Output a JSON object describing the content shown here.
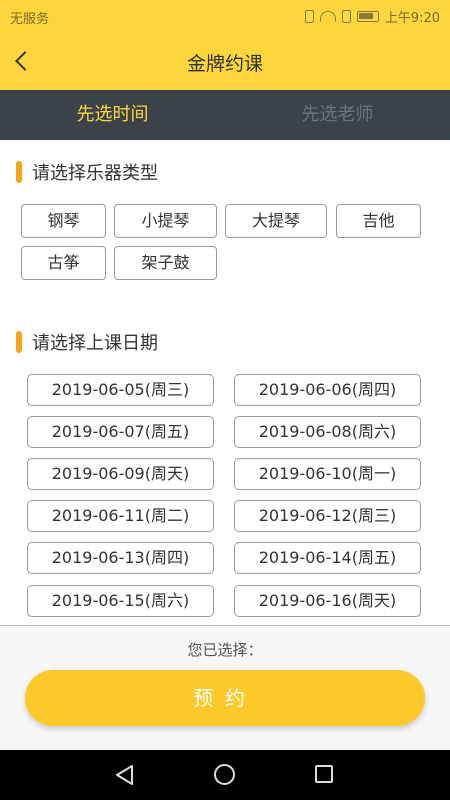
{
  "status_bar": {
    "carrier": "无服务",
    "time": "上午9:20"
  },
  "header": {
    "title": "金牌约课"
  },
  "tabs": [
    {
      "label": "先选时间",
      "active": true
    },
    {
      "label": "先选老师",
      "active": false
    }
  ],
  "instrument_section": {
    "title": "请选择乐器类型",
    "options": [
      "钢琴",
      "小提琴",
      "大提琴",
      "吉他",
      "古筝",
      "架子鼓"
    ]
  },
  "date_section": {
    "title": "请选择上课日期",
    "dates": [
      "2019-06-05(周三)",
      "2019-06-06(周四)",
      "2019-06-07(周五)",
      "2019-06-08(周六)",
      "2019-06-09(周天)",
      "2019-06-10(周一)",
      "2019-06-11(周二)",
      "2019-06-12(周三)",
      "2019-06-13(周四)",
      "2019-06-14(周五)",
      "2019-06-15(周六)",
      "2019-06-16(周天)"
    ]
  },
  "bottom": {
    "selected_label": "您已选择：",
    "book_button": "预约"
  },
  "colors": {
    "accent": "#fcd63c",
    "tab_bar": "#3b4249",
    "section_marker": "#f7a11c",
    "button": "#fcc82a"
  }
}
